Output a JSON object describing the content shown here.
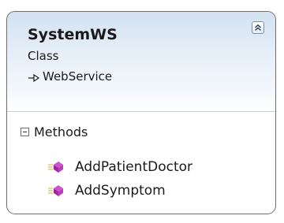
{
  "class": {
    "name": "SystemWS",
    "kind": "Class",
    "base": "WebService",
    "collapse_icon": "double-chevron-up-icon"
  },
  "methods_section": {
    "label": "Methods",
    "toggle_icon": "collapse-minus-icon",
    "items": [
      {
        "name": "AddPatientDoctor",
        "icon": "method-icon"
      },
      {
        "name": "AddSymptom",
        "icon": "method-icon"
      }
    ]
  },
  "colors": {
    "header_gradient_top": "#d3e1f1",
    "border": "#6d6d6d",
    "method_icon": "#b03ab0"
  }
}
